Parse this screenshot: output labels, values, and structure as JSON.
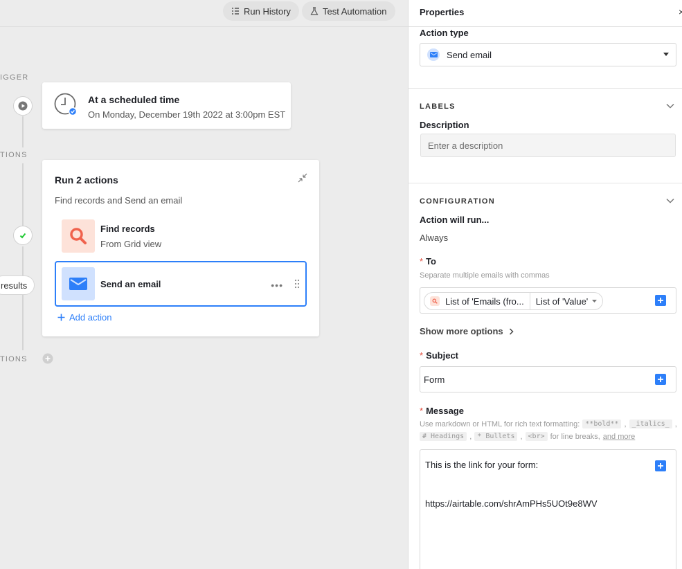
{
  "topbar": {
    "run_history": "Run History",
    "test_automation": "Test Automation"
  },
  "canvas": {
    "trigger_label": "IGGER",
    "actions_label": "TIONS",
    "conditions_label": "TIONS",
    "results_pill": "results",
    "trigger": {
      "title": "At a scheduled time",
      "subtitle": "On Monday, December 19th 2022 at 3:00pm EST"
    },
    "actions_group": {
      "title": "Run 2 actions",
      "subtitle": "Find records and Send an email",
      "items": [
        {
          "name": "Find records",
          "desc": "From Grid view",
          "icon": "search-icon",
          "bg": "#fde2d9",
          "color": "#f0624d"
        },
        {
          "name": "Send an email",
          "desc": "",
          "icon": "envelope-icon",
          "bg": "#d0e1fe",
          "color": "#2d7ff9"
        }
      ],
      "add_action": "Add action"
    }
  },
  "panel": {
    "title": "Properties",
    "close": "×",
    "action_type_label": "Action type",
    "action_type_value": "Send email",
    "labels_section": "LABELS",
    "description_label": "Description",
    "description_placeholder": "Enter a description",
    "configuration_section": "CONFIGURATION",
    "action_will_run_label": "Action will run...",
    "action_will_run_value": "Always",
    "to": {
      "label": "To",
      "help": "Separate multiple emails with commas",
      "token_1": "List of 'Emails (fro...",
      "token_2": "List of 'Value'"
    },
    "show_more": "Show more options",
    "subject": {
      "label": "Subject",
      "value": "Form"
    },
    "message": {
      "label": "Message",
      "help_prefix": "Use markdown or HTML for rich text formatting:",
      "chip_bold": "**bold**",
      "chip_italics": "_italics_",
      "chip_headings": "# Headings",
      "chip_bullets": "* Bullets",
      "chip_br": "<br>",
      "help_suffix": "for line breaks,",
      "and_more": "and more",
      "line1": "This is the link for your form:",
      "line2": "https://airtable.com/shrAmPHs5UOt9e8WV"
    }
  },
  "colors": {
    "accent": "#2d7ff9",
    "required": "#e24b3b",
    "success": "#20c933"
  }
}
